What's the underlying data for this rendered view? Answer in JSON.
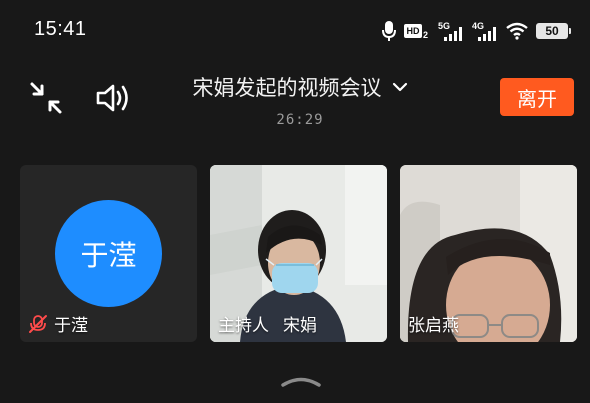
{
  "status_bar": {
    "time": "15:41",
    "hd_label": "HD",
    "hd_sub": "2",
    "net1": "5G",
    "net2": "4G",
    "battery": "50"
  },
  "meeting": {
    "title": "宋娟发起的视频会议",
    "duration": "26:29",
    "leave_label": "离开"
  },
  "participants": [
    {
      "name": "于滢",
      "avatar_text": "于滢",
      "muted": true,
      "host_tag": ""
    },
    {
      "name": "宋娟",
      "host_tag": "主持人"
    },
    {
      "name": "张启燕",
      "host_tag": ""
    }
  ],
  "colors": {
    "background": "#181818",
    "accent_leave": "#ff5a1f",
    "avatar_blue": "#1e8dff",
    "muted_red": "#ff4b4b"
  }
}
